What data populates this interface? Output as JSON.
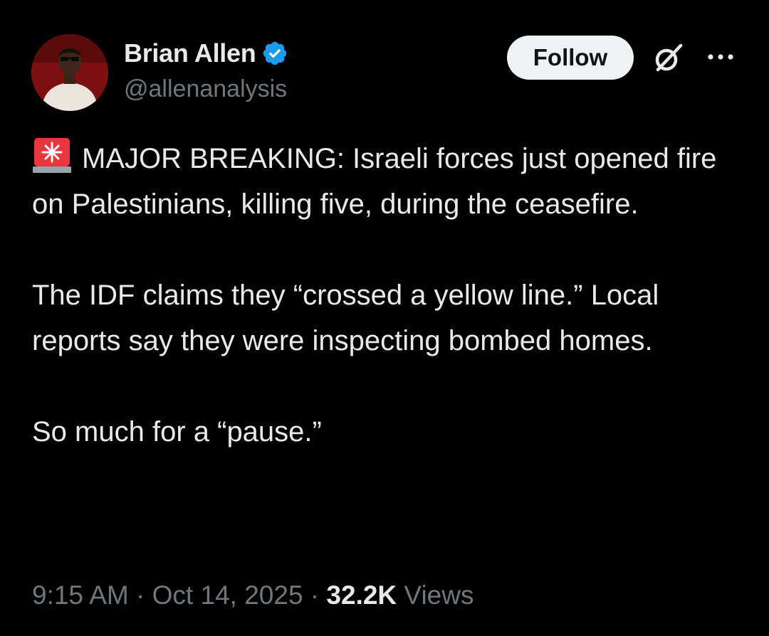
{
  "author": {
    "display_name": "Brian Allen",
    "handle": "@allenanalysis",
    "verified": true,
    "verified_color": "#1d9bf0"
  },
  "actions": {
    "follow_label": "Follow",
    "grok_icon": "grok-icon",
    "more_icon": "more-horizontal-icon"
  },
  "tweet": {
    "emoji": "rotating-light-emoji",
    "paragraphs": [
      "MAJOR BREAKING: Israeli forces just opened fire on Palestinians, killing five, during the ceasefire.",
      "The IDF claims they “crossed a yellow line.” Local reports say they were inspecting bombed homes.",
      "So much for a “pause.”"
    ]
  },
  "meta": {
    "time": "9:15 AM",
    "separator": " · ",
    "date": "Oct 14, 2025",
    "views_count": "32.2K",
    "views_label": " Views"
  },
  "colors": {
    "background": "#000000",
    "text": "#e7e9ea",
    "muted": "#71767b",
    "follow_bg": "#eff3f4"
  }
}
